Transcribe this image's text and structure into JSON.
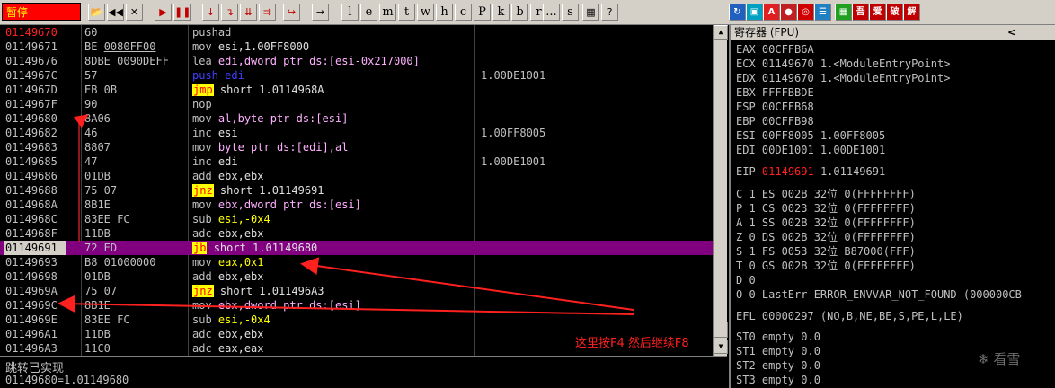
{
  "toolbar": {
    "status": "暂停",
    "letter_buttons": [
      "l",
      "e",
      "m",
      "t",
      "w",
      "h",
      "c",
      "P",
      "k",
      "b",
      "r",
      "...",
      "s"
    ],
    "plugin_buttons": [
      "吾",
      "爱",
      "破",
      "解"
    ]
  },
  "disasm": {
    "rows": [
      {
        "addr": "01149670",
        "hex": "60",
        "mn": "pushad",
        "ops": "",
        "cmt": "",
        "addr_red": true
      },
      {
        "addr": "01149671",
        "hex_pre": "BE ",
        "hex_u": "0080FF00",
        "mn": "mov",
        "ops": "esi,1.00FF8000",
        "cmt": ""
      },
      {
        "addr": "01149676",
        "hex": "8DBE 0090DEFF",
        "mn": "lea",
        "ops": "edi,dword ptr ds:[esi-0x217000]",
        "cmt": ""
      },
      {
        "addr": "0114967C",
        "hex": "57",
        "mn": "push",
        "ops": "edi",
        "cmt": "1.00DE1001"
      },
      {
        "addr": "0114967D",
        "hex": "EB 0B",
        "mn": "jmp",
        "ops": "short 1.0114968A",
        "cmt": ""
      },
      {
        "addr": "0114967F",
        "hex": "90",
        "mn": "nop",
        "ops": "",
        "cmt": ""
      },
      {
        "addr": "01149680",
        "hex": "8A06",
        "mn": "mov",
        "ops": "al,byte ptr ds:[esi]",
        "cmt": ""
      },
      {
        "addr": "01149682",
        "hex": "46",
        "mn": "inc",
        "ops": "esi",
        "cmt": "1.00FF8005"
      },
      {
        "addr": "01149683",
        "hex": "8807",
        "mn": "mov",
        "ops": "byte ptr ds:[edi],al",
        "cmt": ""
      },
      {
        "addr": "01149685",
        "hex": "47",
        "mn": "inc",
        "ops": "edi",
        "cmt": "1.00DE1001"
      },
      {
        "addr": "01149686",
        "hex": "01DB",
        "mn": "add",
        "ops": "ebx,ebx",
        "cmt": ""
      },
      {
        "addr": "01149688",
        "hex": "75 07",
        "mn": "jnz",
        "ops": "short 1.01149691",
        "cmt": ""
      },
      {
        "addr": "0114968A",
        "hex": "8B1E",
        "mn": "mov",
        "ops": "ebx,dword ptr ds:[esi]",
        "cmt": ""
      },
      {
        "addr": "0114968C",
        "hex": "83EE FC",
        "mn": "sub",
        "ops": "esi,-0x4",
        "cmt": ""
      },
      {
        "addr": "0114968F",
        "hex": "11DB",
        "mn": "adc",
        "ops": "ebx,ebx",
        "cmt": ""
      },
      {
        "addr": "01149691",
        "hex": "72 ED",
        "mn": "jb",
        "ops": "short 1.01149680",
        "cmt": "",
        "selected": true
      },
      {
        "addr": "01149693",
        "hex": "B8 01000000",
        "mn": "mov",
        "ops": "eax,0x1",
        "cmt": ""
      },
      {
        "addr": "01149698",
        "hex": "01DB",
        "mn": "add",
        "ops": "ebx,ebx",
        "cmt": ""
      },
      {
        "addr": "0114969A",
        "hex": "75 07",
        "mn": "jnz",
        "ops": "short 1.011496A3",
        "cmt": ""
      },
      {
        "addr": "0114969C",
        "hex": "8B1E",
        "mn": "mov",
        "ops": "ebx,dword ptr ds:[esi]",
        "cmt": ""
      },
      {
        "addr": "0114969E",
        "hex": "83EE FC",
        "mn": "sub",
        "ops": "esi,-0x4",
        "cmt": ""
      },
      {
        "addr": "011496A1",
        "hex": "11DB",
        "mn": "adc",
        "ops": "ebx,ebx",
        "cmt": ""
      },
      {
        "addr": "011496A3",
        "hex": "11C0",
        "mn": "adc",
        "ops": "eax,eax",
        "cmt": ""
      }
    ]
  },
  "info": {
    "line1": "跳转已实现",
    "line2": "01149680=1.01149680"
  },
  "registers": {
    "title": "寄存器 (FPU)",
    "eax": "EAX 00CFFB6A",
    "ecx": "ECX 01149670 1.<ModuleEntryPoint>",
    "edx": "EDX 01149670 1.<ModuleEntryPoint>",
    "ebx": "EBX FFFFBBDE",
    "esp": "ESP 00CFFB68",
    "ebp": "EBP 00CFFB98",
    "esi": "ESI 00FF8005 1.00FF8005",
    "edi": "EDI 00DE1001 1.00DE1001",
    "eip_label": "EIP",
    "eip_value": "01149691",
    "eip_cmt": "1.01149691",
    "flags": [
      "C 1  ES 002B 32位 0(FFFFFFFF)",
      "P 1  CS 0023 32位 0(FFFFFFFF)",
      "A 1  SS 002B 32位 0(FFFFFFFF)",
      "Z 0  DS 002B 32位 0(FFFFFFFF)",
      "S 1  FS 0053 32位 B87000(FFF)",
      "T 0  GS 002B 32位 0(FFFFFFFF)",
      "D 0",
      "O 0  LastErr ERROR_ENVVAR_NOT_FOUND (000000CB"
    ],
    "efl": "EFL 00000297 (NO,B,NE,BE,S,PE,L,LE)",
    "st": [
      "ST0 empty 0.0",
      "ST1 empty 0.0",
      "ST2 empty 0.0",
      "ST3 empty 0.0"
    ]
  },
  "annotation": "这里按F4 然后继续F8",
  "watermark": "看雪",
  "colors": {
    "selection": "#800080",
    "jump_highlight": "#ffff00",
    "annotation": "#ff2020"
  }
}
